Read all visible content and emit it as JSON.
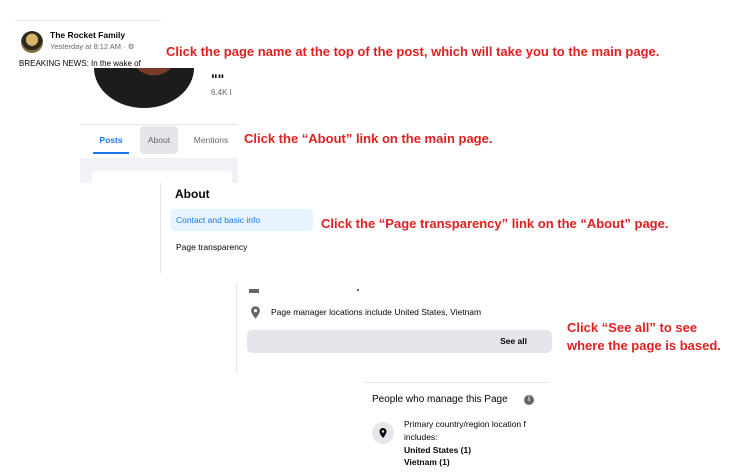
{
  "post_header": {
    "page_name": "The Rocket Family",
    "timestamp": "Yesterday at 8:12 AM · ",
    "snippet": "BREAKING NEWS: In the wake of"
  },
  "main_page": {
    "title_fragment": "\"\"",
    "followers": "6.4K I",
    "tabs": [
      "Posts",
      "About",
      "Mentions"
    ]
  },
  "about_sidebar": {
    "heading": "About",
    "items": [
      "Contact and basic info",
      "Page transparency"
    ]
  },
  "transparency": {
    "location_text": "Page manager locations include United States, Vietnam",
    "see_all_label": "See all"
  },
  "managers": {
    "heading": "People who manage this Page",
    "info_icon": "i",
    "line1": "Primary country/region location f",
    "line2": "includes:",
    "line3": "United States (1)",
    "line4": "Vietnam (1)"
  },
  "instructions": {
    "step1": "Click the page name at the top of the post, which will take you to the main page.",
    "step2": "Click the “About” link on the main page.",
    "step3": "Click the “Page transparency” link on the “About” page.",
    "step4_line1": "Click “See all” to see",
    "step4_line2": "where the page is based."
  },
  "colors": {
    "instruction_red": "#e02020",
    "facebook_blue": "#1877f2",
    "active_item_bg": "#e7f3ff",
    "button_grey": "#e4e6eb"
  }
}
